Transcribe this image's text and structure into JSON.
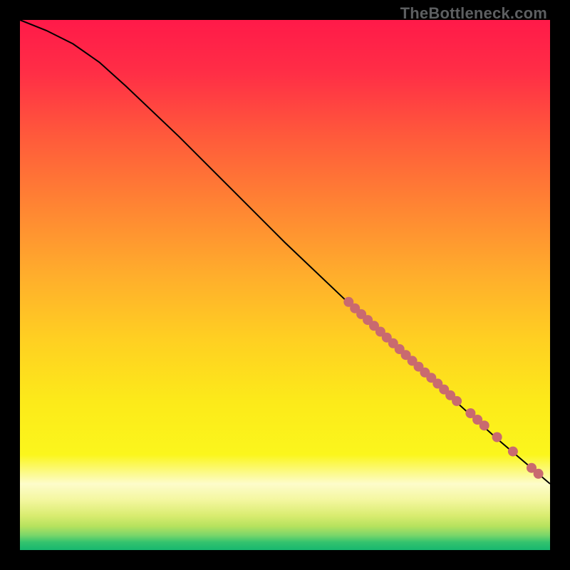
{
  "watermark": "TheBottleneck.com",
  "chart_data": {
    "type": "line",
    "xlim": [
      0,
      100
    ],
    "ylim": [
      0,
      100
    ],
    "curve": [
      {
        "x": 0,
        "y": 100
      },
      {
        "x": 5,
        "y": 98
      },
      {
        "x": 10,
        "y": 95.5
      },
      {
        "x": 15,
        "y": 92
      },
      {
        "x": 20,
        "y": 87.5
      },
      {
        "x": 30,
        "y": 78
      },
      {
        "x": 40,
        "y": 68
      },
      {
        "x": 50,
        "y": 58
      },
      {
        "x": 60,
        "y": 48.5
      },
      {
        "x": 70,
        "y": 39
      },
      {
        "x": 80,
        "y": 30
      },
      {
        "x": 90,
        "y": 21
      },
      {
        "x": 100,
        "y": 12.5
      }
    ],
    "markers": [
      {
        "x": 62.0,
        "y": 46.8
      },
      {
        "x": 63.2,
        "y": 45.6
      },
      {
        "x": 64.4,
        "y": 44.5
      },
      {
        "x": 65.6,
        "y": 43.4
      },
      {
        "x": 66.8,
        "y": 42.3
      },
      {
        "x": 68.0,
        "y": 41.2
      },
      {
        "x": 69.2,
        "y": 40.1
      },
      {
        "x": 70.4,
        "y": 39.0
      },
      {
        "x": 71.6,
        "y": 37.9
      },
      {
        "x": 72.8,
        "y": 36.8
      },
      {
        "x": 74.0,
        "y": 35.7
      },
      {
        "x": 75.2,
        "y": 34.6
      },
      {
        "x": 76.4,
        "y": 33.5
      },
      {
        "x": 77.6,
        "y": 32.5
      },
      {
        "x": 78.8,
        "y": 31.4
      },
      {
        "x": 80.0,
        "y": 30.3
      },
      {
        "x": 81.2,
        "y": 29.2
      },
      {
        "x": 82.4,
        "y": 28.1
      },
      {
        "x": 85.0,
        "y": 25.8
      },
      {
        "x": 86.3,
        "y": 24.6
      },
      {
        "x": 87.6,
        "y": 23.5
      },
      {
        "x": 90.0,
        "y": 21.3
      },
      {
        "x": 93.0,
        "y": 18.6
      },
      {
        "x": 96.5,
        "y": 15.5
      },
      {
        "x": 97.8,
        "y": 14.4
      }
    ],
    "gradient_bands": [
      {
        "stop": 0.0,
        "color": "#ff1a49"
      },
      {
        "stop": 0.1,
        "color": "#ff2e46"
      },
      {
        "stop": 0.22,
        "color": "#ff5a3b"
      },
      {
        "stop": 0.35,
        "color": "#ff8433"
      },
      {
        "stop": 0.48,
        "color": "#ffad2c"
      },
      {
        "stop": 0.6,
        "color": "#ffcf22"
      },
      {
        "stop": 0.72,
        "color": "#fcea1a"
      },
      {
        "stop": 0.82,
        "color": "#fbf61c"
      },
      {
        "stop": 0.875,
        "color": "#fdfccb"
      },
      {
        "stop": 0.905,
        "color": "#f4f7a0"
      },
      {
        "stop": 0.935,
        "color": "#d9ec70"
      },
      {
        "stop": 0.955,
        "color": "#b6e25e"
      },
      {
        "stop": 0.972,
        "color": "#7ad66a"
      },
      {
        "stop": 0.985,
        "color": "#34c36e"
      },
      {
        "stop": 1.0,
        "color": "#17b86f"
      }
    ],
    "marker_color": "#c96a6f",
    "line_color": "#000000"
  }
}
